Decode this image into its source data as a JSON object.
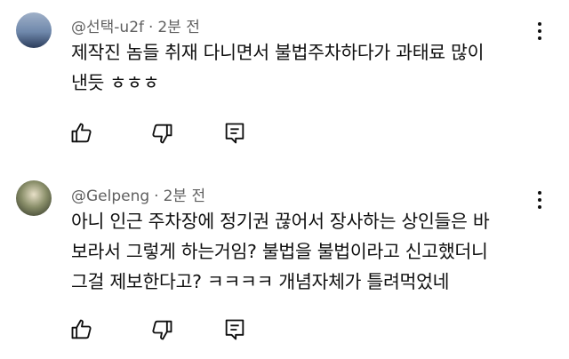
{
  "comments": [
    {
      "author": "@선택-u2f",
      "time": "2분 전",
      "lines": [
        "제작진 놈들 취재 다니면서 불법주차하다가 과태료 많이",
        "낸듯 ㅎㅎㅎ"
      ],
      "avatar_icon": "avatar-image"
    },
    {
      "author": "@Gelpeng",
      "time": "2분 전",
      "lines": [
        "아니 인근 주차장에 정기권 끊어서 장사하는 상인들은 바",
        "보라서 그렇게 하는거임? 불법을 불법이라고 신고했더니",
        "그걸 제보한다고? ㅋㅋㅋㅋ 개념자체가 틀려먹었네"
      ],
      "avatar_icon": "avatar-image"
    }
  ],
  "icons": {
    "like": "thumbs-up-icon",
    "dislike": "thumbs-down-icon",
    "reply": "reply-icon",
    "more": "more-vertical-icon"
  },
  "colors": {
    "text": "#0f0f0f",
    "meta": "#606060",
    "background": "#ffffff"
  }
}
